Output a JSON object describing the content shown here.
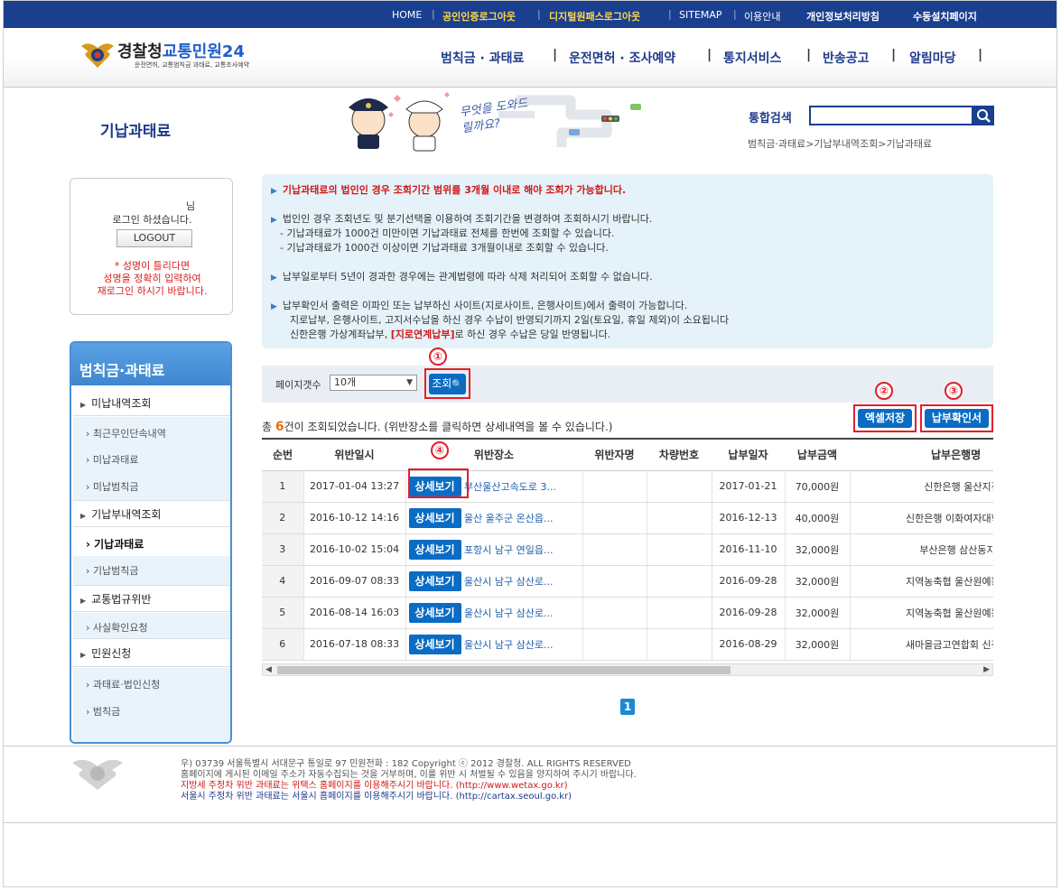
{
  "topbar": {
    "links": [
      "HOME",
      "공인인증로그아웃",
      "디지털원패스로그아웃",
      "SITEMAP",
      "이용안내",
      "개인정보처리방침",
      "수동설치페이지"
    ]
  },
  "logo": {
    "title_prefix": "경찰청",
    "title_main": "교통민원24",
    "subtitle": "운전면허, 교통범칙금 과태료, 교통조사예약"
  },
  "gnav": [
    "범칙금 · 과태료",
    "운전면허 · 조사예약",
    "통지서비스",
    "반송공고",
    "알림마당"
  ],
  "page_title": "기납과태료",
  "banner_text": "무엇을 도와드릴까요?",
  "search": {
    "label": "통합검색",
    "value": ""
  },
  "breadcrumb": "범칙금·과태료>기납부내역조회>기납과태료",
  "login_box": {
    "suffix": "님",
    "logged_in": "로그인 하셨습니다.",
    "logout": "LOGOUT",
    "warn1": "* 성명이 틀리다면",
    "warn2": "성명을 정확히 입력하여",
    "warn3": "재로그인 하시기 바랍니다."
  },
  "sidebar": {
    "title": "범칙금·과태료",
    "groups": [
      {
        "label": "미납내역조회",
        "items": [
          "최근무인단속내역",
          "미납과태료",
          "미납범칙금"
        ]
      },
      {
        "label": "기납부내역조회",
        "items": [
          "기납과태료",
          "기납범칙금"
        ]
      },
      {
        "label": "교통법규위반",
        "items": [
          "사실확인요청"
        ]
      },
      {
        "label": "민원신청",
        "items": [
          "과태료·법인신청",
          "범칙금"
        ]
      }
    ]
  },
  "notices": {
    "n1": "기납과태료의 법인인 경우 조회기간 범위를 3개월 이내로 해야 조회가 가능합니다.",
    "n2": "법인인 경우 조회년도 및 분기선택을 이용하여 조회기간을 변경하여 조회하시기 바랍니다.",
    "n2a": "- 기납과태료가 1000건 미만이면 기납과태료 전체를 한번에 조회할 수 있습니다.",
    "n2b": "- 기납과태료가 1000건 이상이면 기납과태료 3개월이내로 조회할 수 있습니다.",
    "n3": "납부일로부터 5년이 경과한 경우에는 관계법령에 따라 삭제 처리되어 조회할 수 없습니다.",
    "n4": "납부확인서 출력은 이파인 또는 납부하신 사이트(지로사이트, 은행사이트)에서 출력이 가능합니다.",
    "n4a": "지로납부, 은행사이트, 고지서수납을 하신 경우 수납이 반영되기까지 2일(토요일, 휴일 제외)이 소요됩니다",
    "n4b_pre": "신한은행 가상계좌납부, ",
    "n4b_red": "[지로연계납부]",
    "n4b_post": "로 하신 경우 수납은 당일 반영됩니다."
  },
  "filter": {
    "label": "페이지갯수",
    "selected": "10개",
    "search_button": "조회"
  },
  "markers": [
    "①",
    "②",
    "③",
    "④"
  ],
  "actions": {
    "excel": "엑셀저장",
    "receipt": "납부확인서"
  },
  "summary": {
    "prefix": "총 ",
    "count": "6",
    "suffix": "건이 조회되었습니다. (위반장소를 클릭하면 상세내역을 볼 수 있습니다.)"
  },
  "table": {
    "columns": [
      "순번",
      "위반일시",
      "위반장소",
      "위반자명",
      "차량번호",
      "납부일자",
      "납부금액",
      "납부은행명"
    ],
    "detail_label": "상세보기",
    "rows": [
      {
        "no": "1",
        "date": "2017-01-04 13:27",
        "place": "부산울산고속도로 3...",
        "name": "",
        "car": "",
        "paid": "2017-01-21",
        "amount": "70,000원",
        "bank": "신한은행 울산지점"
      },
      {
        "no": "2",
        "date": "2016-10-12 14:16",
        "place": "울산 울주군 온산읍...",
        "name": "",
        "car": "",
        "paid": "2016-12-13",
        "amount": "40,000원",
        "bank": "신한은행 이화여자대학교지"
      },
      {
        "no": "3",
        "date": "2016-10-02 15:04",
        "place": "포항시 남구 연일읍...",
        "name": "",
        "car": "",
        "paid": "2016-11-10",
        "amount": "32,000원",
        "bank": "부산은행 삼산동지점"
      },
      {
        "no": "4",
        "date": "2016-09-07 08:33",
        "place": "울산시 남구 삼산로...",
        "name": "",
        "car": "",
        "paid": "2016-09-28",
        "amount": "32,000원",
        "bank": "지역농축협 울산원예농협공"
      },
      {
        "no": "5",
        "date": "2016-08-14 16:03",
        "place": "울산시 남구 삼산로...",
        "name": "",
        "car": "",
        "paid": "2016-09-28",
        "amount": "32,000원",
        "bank": "지역농축협 울산원예농협공"
      },
      {
        "no": "6",
        "date": "2016-07-18 08:33",
        "place": "울산시 남구 삼산로...",
        "name": "",
        "car": "",
        "paid": "2016-08-29",
        "amount": "32,000원",
        "bank": "새마을금고연합회 신정팔동"
      }
    ]
  },
  "pagination": {
    "current": "1"
  },
  "footer": {
    "line1": "우) 03739 서울특별시 서대문구 통일로 97 민원전화 : 182       Copyright ⓒ 2012 경찰청. ALL RIGHTS RESERVED",
    "line2": "홈페이지에 게시된 이메일 주소가 자동수집되는 것을 거부하며, 이를 위반 시 처벌될 수 있음을 양지하여 주시기 바랍니다.",
    "line3": "지방세 주정차 위반 과태료는 위택스 홈페이지를 이용해주시기 바랍니다. (http://www.wetax.go.kr)",
    "line4": "서울시 주정차 위반 과태료는 서울시 홈페이지를 이용해주시기 바랍니다. (http://cartax.seoul.go.kr)"
  },
  "colors": {
    "brand_navy": "#1a3f8f",
    "button_blue": "#0a6cc4",
    "highlight_red": "#e0202c",
    "orange_count": "#e8720c"
  }
}
